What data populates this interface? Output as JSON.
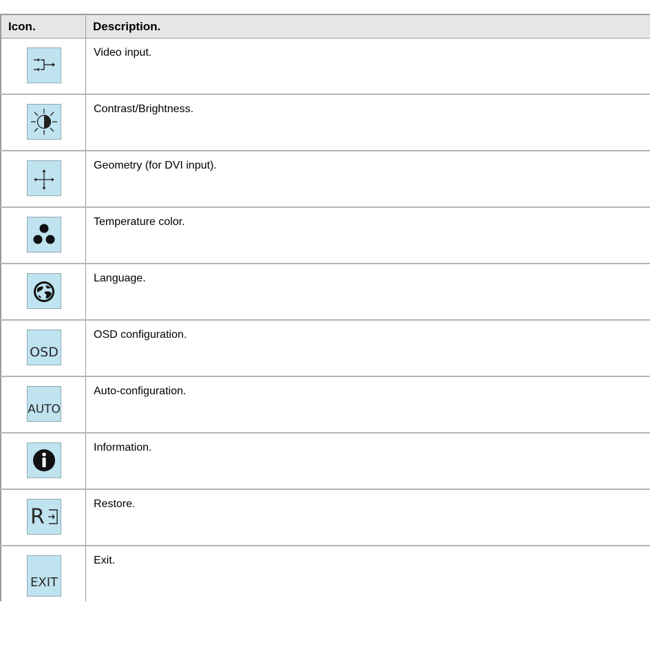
{
  "table": {
    "headers": {
      "icon": "Icon.",
      "description": "Description."
    },
    "rows": [
      {
        "icon": "video-input-icon",
        "description": "Video input."
      },
      {
        "icon": "contrast-brightness-icon",
        "description": "Contrast/Brightness."
      },
      {
        "icon": "geometry-icon",
        "description": "Geometry (for DVI input)."
      },
      {
        "icon": "temperature-color-icon",
        "description": "Temperature color."
      },
      {
        "icon": "language-icon",
        "description": "Language."
      },
      {
        "icon": "osd-icon",
        "icon_text": "OSD",
        "description": "OSD configuration."
      },
      {
        "icon": "auto-icon",
        "icon_text": "AUTO",
        "description": "Auto-configuration."
      },
      {
        "icon": "information-icon",
        "description": "Information."
      },
      {
        "icon": "restore-icon",
        "icon_text": "R",
        "description": "Restore."
      },
      {
        "icon": "exit-icon",
        "icon_text": "EXIT",
        "description": "Exit."
      }
    ]
  },
  "colors": {
    "icon_background": "#bfe3ef",
    "header_background": "#e6e6e6",
    "rule": "#9b9b9b"
  }
}
